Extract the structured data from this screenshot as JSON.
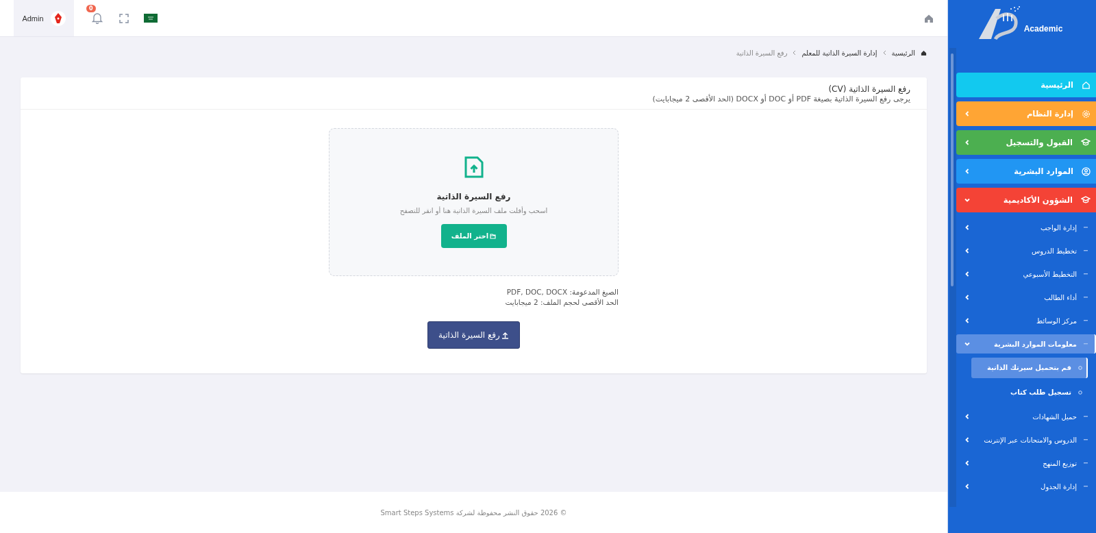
{
  "header": {
    "user": "Admin",
    "notifications": "0"
  },
  "breadcrumb": [
    {
      "label": "الرئيسية",
      "current": false
    },
    {
      "label": "إدارة السيرة الذاتية للمعلم",
      "current": false
    },
    {
      "label": "رفع السيرة الذاتية",
      "current": true
    }
  ],
  "card": {
    "title": "رفع السيرة الذاتية (CV)",
    "subtitle": "يرجى رفع السيرة الذاتية بصيغة PDF أو DOC أو DOCX (الحد الأقصى 2 ميجابايت)",
    "dropzone": {
      "title": "رفع السيرة الذاتية",
      "hint": "اسحب وأفلت ملف السيرة الذاتية هنا أو انقر للتصفح",
      "button": "اختر الملف"
    },
    "info": [
      "الصيغ المدعومة: PDF, DOC, DOCX",
      "الحد الأقصى لحجم الملف: 2 ميجابايت"
    ],
    "submit": "رفع السيرة الذاتية"
  },
  "footer": "© 2026 حقوق النشر محفوظة لشركة Smart Steps Systems",
  "sidebar": {
    "logo": "Academic",
    "items": [
      {
        "label": "الرئيسية",
        "kind": "link",
        "color": "#12c9ef"
      },
      {
        "label": "إدارة النظام",
        "kind": "menu",
        "color": "#ffa534",
        "expanded": false
      },
      {
        "label": "القبول والتسجيل",
        "kind": "menu",
        "color": "#4caf50",
        "expanded": false
      },
      {
        "label": "الموارد البشرية",
        "kind": "menu",
        "color": "#2196f3",
        "expanded": false
      },
      {
        "label": "الشؤون الأكاديمية",
        "kind": "menu",
        "color": "#f44336",
        "expanded": true,
        "children": [
          {
            "label": "إدارة الواجب",
            "expanded": false
          },
          {
            "label": "تخطيط الدروس",
            "expanded": false
          },
          {
            "label": "التخطيط الأسبوعي",
            "expanded": false
          },
          {
            "label": "أداء الطالب",
            "expanded": false
          },
          {
            "label": "مركز الوسائط",
            "expanded": false
          },
          {
            "label": "معلومات الموارد البشرية",
            "expanded": true,
            "children": [
              {
                "label": "قم بتحميل سيرتك الذاتية",
                "selected": true
              },
              {
                "label": "تسجيل طلب كتاب",
                "selected": false
              }
            ]
          },
          {
            "label": "حميل الشهادات",
            "expanded": false
          },
          {
            "label": "الدروس والامتحانات عبر الإنترنت",
            "expanded": false
          },
          {
            "label": "توزيع المنهج",
            "expanded": false
          },
          {
            "label": "إدارة الجدول",
            "expanded": false
          }
        ]
      }
    ]
  }
}
